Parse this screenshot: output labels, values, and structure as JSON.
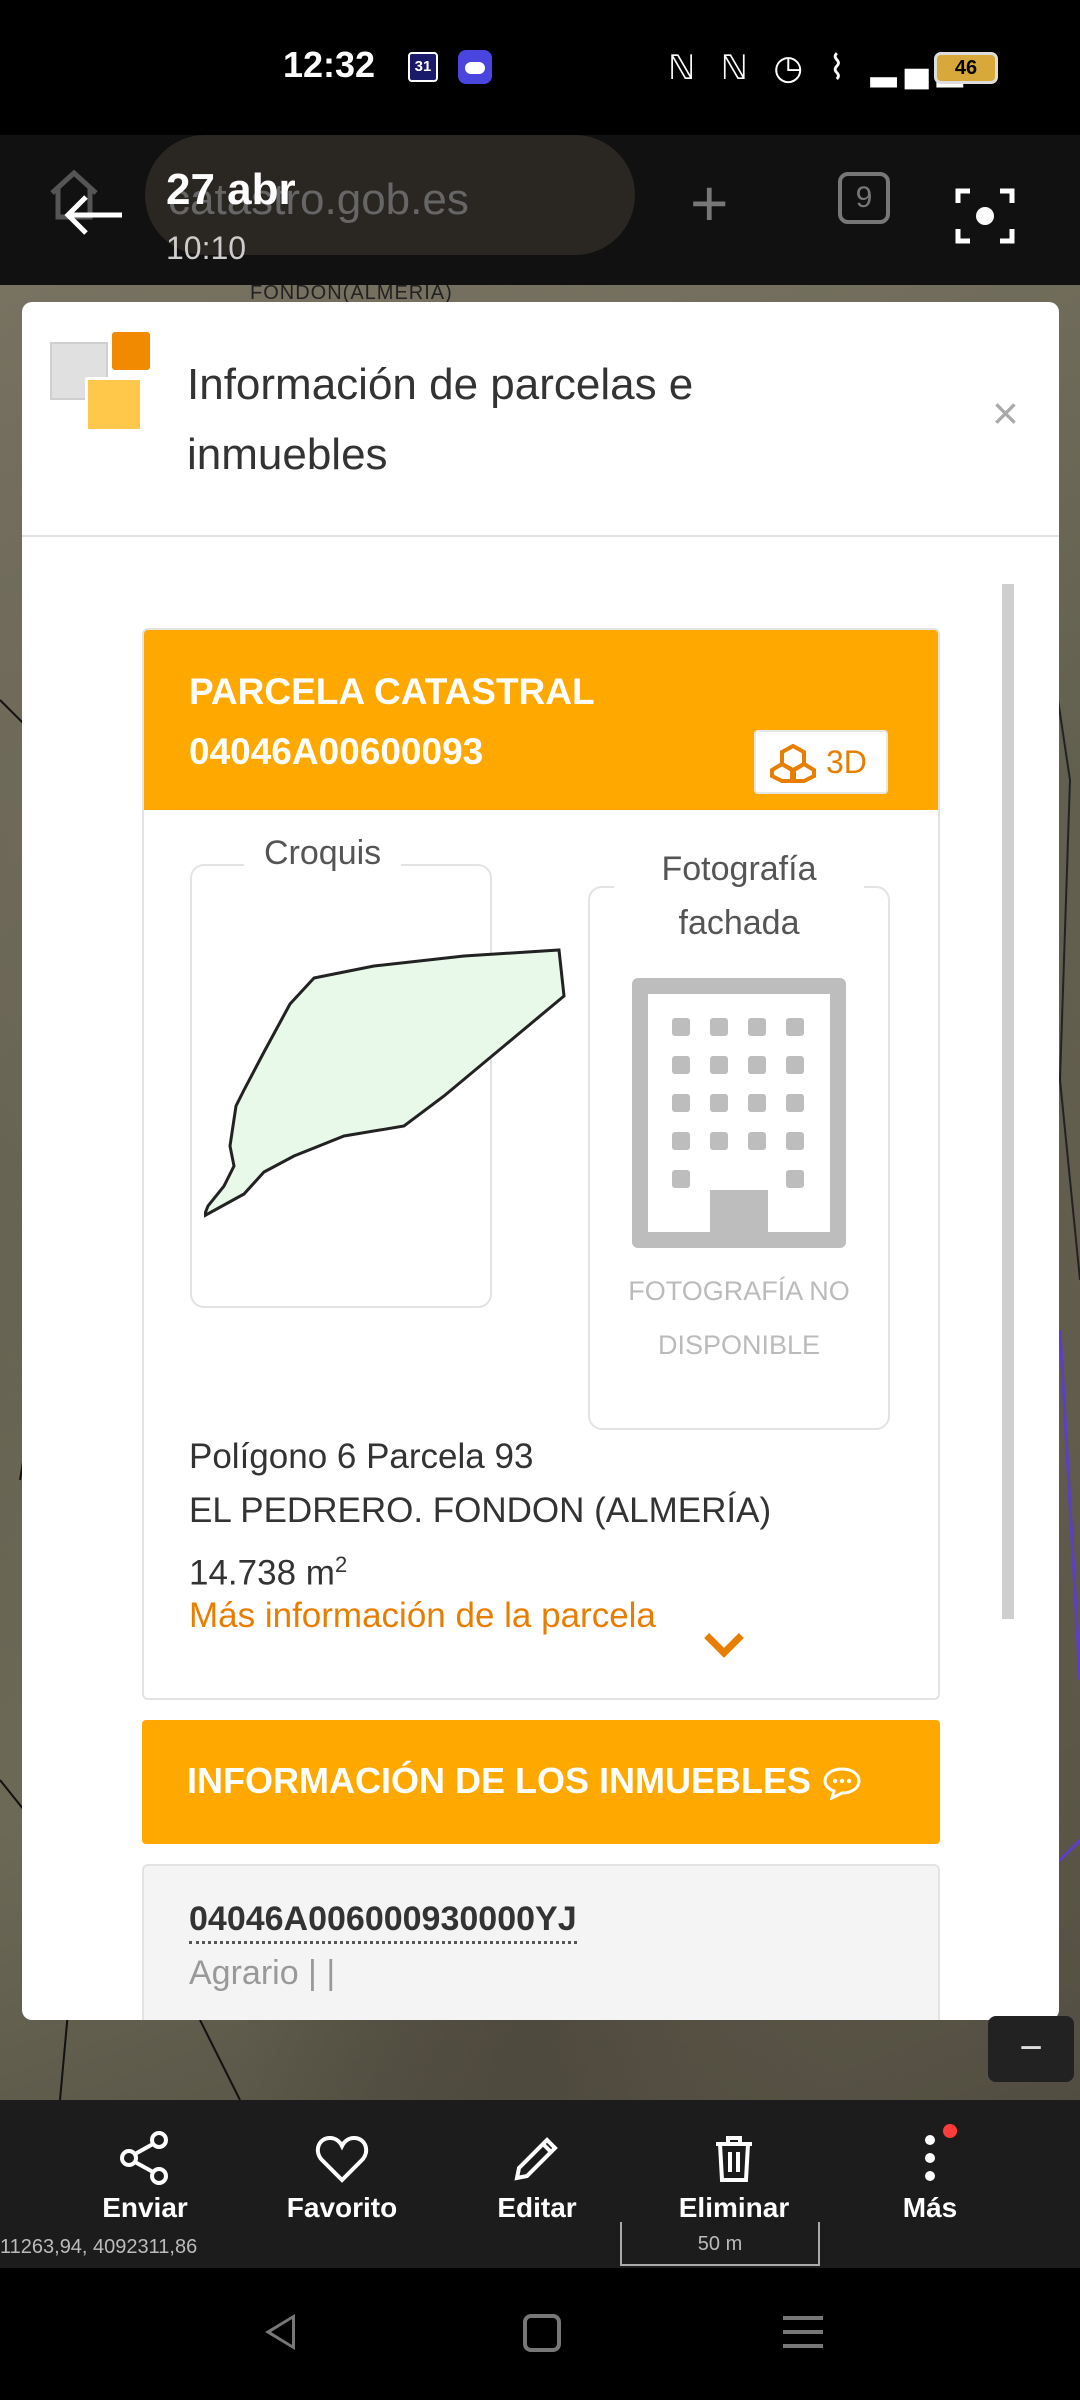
{
  "status_bar": {
    "time": "12:32",
    "calendar_day": "31",
    "icons": "ℕ ℕ ◷ ⌇ ▂▄▆",
    "battery": "46"
  },
  "browser": {
    "date": "27 abr",
    "url": "catastro.gob.es",
    "time": "10:10",
    "tab_count": "9"
  },
  "map": {
    "top_label": "FONDON(ALMERIA)",
    "coords": "11263,94, 4092311,86",
    "scale": "50 m"
  },
  "modal": {
    "title": "Información de parcelas e inmuebles",
    "close": "×"
  },
  "parcel": {
    "heading": "PARCELA CATASTRAL 04046A00600093",
    "btn_3d": "3D",
    "croquis_label": "Croquis",
    "foto_label": "Fotografía fachada",
    "foto_unavailable": "FOTOGRAFÍA NO DISPONIBLE",
    "line1": "Polígono 6 Parcela 93",
    "line2": "EL PEDRERO. FONDON (ALMERÍA)",
    "area_value": "14.738 m",
    "area_sup": "2",
    "more_info": "Más información de la parcela"
  },
  "inmuebles": {
    "title": "INFORMACIÓN DE LOS INMUEBLES",
    "ref": "04046A006000930000YJ",
    "sub": "Agrario | |"
  },
  "toolbar": {
    "items": [
      {
        "label": "Enviar",
        "icon": "share-icon"
      },
      {
        "label": "Favorito",
        "icon": "heart-icon"
      },
      {
        "label": "Editar",
        "icon": "pencil-icon"
      },
      {
        "label": "Eliminar",
        "icon": "trash-icon"
      },
      {
        "label": "Más",
        "icon": "more-vertical-icon"
      }
    ],
    "zoom_out": "−"
  },
  "colors": {
    "accent_orange": "#ffa800",
    "link_orange": "#e87e00",
    "parcel_fill": "#e8f9ea"
  }
}
